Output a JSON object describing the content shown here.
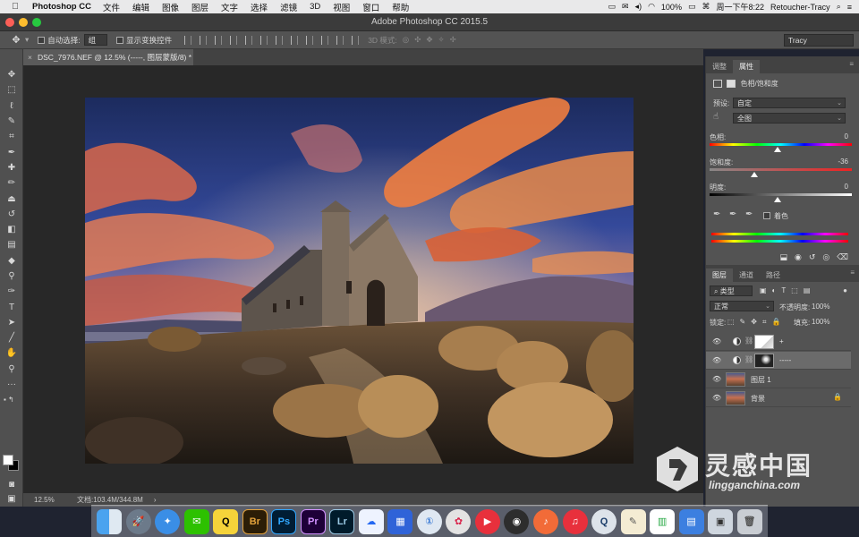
{
  "menubar": {
    "apple": "",
    "app": "Photoshop CC",
    "items": [
      "文件",
      "编辑",
      "图像",
      "图层",
      "文字",
      "选择",
      "滤镜",
      "3D",
      "视图",
      "窗口",
      "帮助"
    ],
    "battery": "100%",
    "datetime": "周一下午8:22",
    "user": "Retoucher-Tracy"
  },
  "window": {
    "title": "Adobe Photoshop CC 2015.5"
  },
  "optionsbar": {
    "auto_select_label": "自动选择:",
    "auto_select_value": "组",
    "show_transform_label": "显示变换控件",
    "mode3d_label": "3D 模式:",
    "workspace": "Tracy"
  },
  "document": {
    "tab_title": "DSC_7976.NEF @ 12.5% (-----, 图层蒙版/8) *",
    "zoom": "12.5%",
    "doc_info": "文档:103.4M/344.8M",
    "arrow": "›"
  },
  "properties": {
    "tabs": [
      "调整",
      "属性"
    ],
    "header": "色相/饱和度",
    "preset_label": "预设:",
    "preset_value": "自定",
    "channel_value": "全图",
    "hue_label": "色相:",
    "hue_value": "0",
    "saturation_label": "饱和度:",
    "saturation_value": "-36",
    "lightness_label": "明度:",
    "lightness_value": "0",
    "colorize_label": "着色"
  },
  "layers": {
    "tabs": [
      "图层",
      "通道",
      "路径"
    ],
    "filter_label": "类型",
    "blend_mode": "正常",
    "opacity_label": "不透明度:",
    "opacity_value": "100%",
    "lock_label": "锁定:",
    "fill_label": "填充:",
    "fill_value": "100%",
    "items": [
      {
        "name": "+",
        "type": "adjustment"
      },
      {
        "name": "-----",
        "type": "adjustment"
      },
      {
        "name": "图层 1",
        "type": "pixel"
      },
      {
        "name": "背景",
        "type": "background"
      }
    ]
  },
  "toolbar_tools": [
    "move-tool",
    "marquee-tool",
    "lasso-tool",
    "quick-select-tool",
    "crop-tool",
    "eyedropper-tool",
    "healing-tool",
    "brush-tool",
    "clone-stamp-tool",
    "history-brush-tool",
    "eraser-tool",
    "gradient-tool",
    "blur-tool",
    "dodge-tool",
    "pen-tool",
    "type-tool",
    "path-select-tool",
    "line-tool",
    "hand-tool",
    "zoom-tool",
    "more-tools"
  ],
  "dock": {
    "apps": [
      "finder",
      "launchpad",
      "safari",
      "wechat",
      "qq",
      "Br",
      "Ps",
      "Pr",
      "Lr",
      "baidu-cloud",
      "photo-app",
      "dictionary",
      "davinci",
      "player",
      "obs",
      "music",
      "netease",
      "quicktime",
      "textedit",
      "numbers",
      "keynote",
      "preview",
      "trash"
    ]
  },
  "watermark": {
    "cn": "灵感中国",
    "en": "lingganchina.com"
  },
  "colors": {
    "accent": "#27c840",
    "panel": "#535353",
    "dark": "#282828"
  }
}
